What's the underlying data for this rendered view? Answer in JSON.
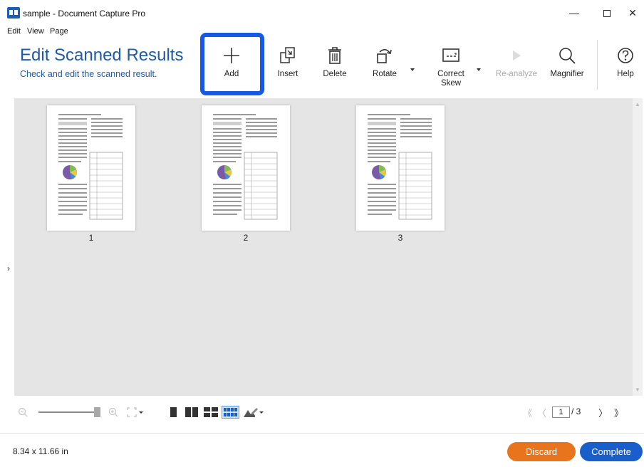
{
  "window": {
    "title": "sample - Document Capture Pro",
    "minimize": "—",
    "close": "✕"
  },
  "menu": {
    "items": [
      "Edit",
      "View",
      "Page"
    ]
  },
  "header": {
    "title": "Edit Scanned Results",
    "subtitle": "Check and edit the scanned result."
  },
  "toolbar": {
    "add": "Add",
    "insert": "Insert",
    "delete": "Delete",
    "rotate": "Rotate",
    "correct_skew": "Correct\nSkew",
    "reanalyze": "Re-analyze",
    "magnifier": "Magnifier",
    "help": "Help"
  },
  "pages": [
    {
      "number": "1"
    },
    {
      "number": "2"
    },
    {
      "number": "3"
    }
  ],
  "pager": {
    "first": "《",
    "prev": "〈",
    "current": "1",
    "total": "/ 3",
    "next": "〉",
    "last": "》"
  },
  "status": {
    "dimensions": "8.34 x 11.66 in"
  },
  "actions": {
    "discard": "Discard",
    "complete": "Complete"
  },
  "colors": {
    "accent": "#1e5aa8",
    "highlight": "#1559e6",
    "discard": "#e8741e",
    "complete": "#1a5ec9"
  }
}
